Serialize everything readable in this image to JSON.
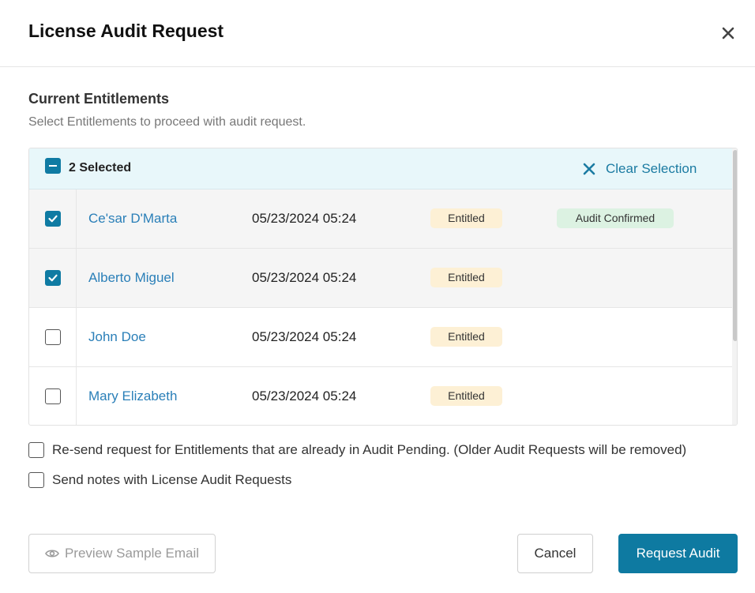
{
  "dialog": {
    "title": "License Audit Request"
  },
  "section": {
    "title": "Current Entitlements",
    "subtitle": "Select Entitlements to proceed with audit request."
  },
  "selection": {
    "count_label": "2 Selected",
    "clear_label": "Clear Selection"
  },
  "rows": [
    {
      "name": "Ce'sar D'Marta",
      "date": "05/23/2024 05:24",
      "entitlement": "Entitled",
      "audit_status": "Audit Confirmed",
      "checked": true
    },
    {
      "name": "Alberto Miguel",
      "date": "05/23/2024 05:24",
      "entitlement": "Entitled",
      "audit_status": "",
      "checked": true
    },
    {
      "name": "John Doe",
      "date": "05/23/2024 05:24",
      "entitlement": "Entitled",
      "audit_status": "",
      "checked": false
    },
    {
      "name": "Mary Elizabeth",
      "date": "05/23/2024 05:24",
      "entitlement": "Entitled",
      "audit_status": "",
      "checked": false
    }
  ],
  "options": {
    "resend_label": "Re-send request for Entitlements that are already in Audit Pending. (Older Audit Requests will be removed)",
    "resend_checked": false,
    "notes_label": "Send notes with License Audit Requests",
    "notes_checked": false
  },
  "buttons": {
    "preview_label": "Preview Sample Email",
    "cancel_label": "Cancel",
    "request_label": "Request Audit"
  },
  "colors": {
    "accent": "#0e7aa1",
    "link": "#2a7fb8",
    "entitled_badge": "#fdf0d5",
    "confirmed_badge": "#dcf2e2",
    "selection_bar": "#e8f7fa"
  },
  "icons": {
    "close": "close-icon",
    "clear": "x-icon",
    "preview": "eye-icon",
    "check": "check-icon",
    "indeterminate": "minus-icon"
  }
}
